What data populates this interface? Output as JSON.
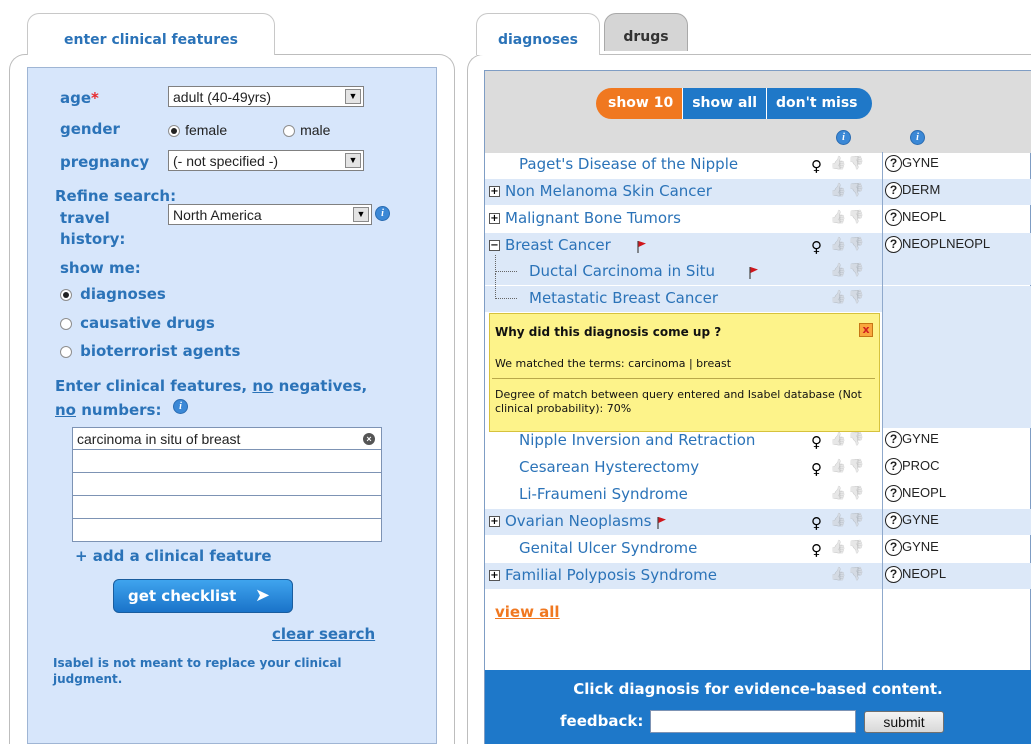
{
  "left_tab": {
    "label": "enter clinical features"
  },
  "form": {
    "age_label": "age",
    "age_required_mark": "*",
    "age_value": "adult (40-49yrs)",
    "gender_label": "gender",
    "gender_options": [
      "female",
      "male"
    ],
    "gender_selected": "female",
    "pregnancy_label": "pregnancy",
    "pregnancy_value": "(- not specified -)",
    "refine_label": "Refine search:",
    "travel_label_1": "travel",
    "travel_label_2": "history:",
    "travel_value": "North America",
    "show_me_label": "show me:",
    "show_me_options": [
      "diagnoses",
      "causative drugs",
      "bioterrorist agents"
    ],
    "show_me_selected": "diagnoses",
    "features_heading_1": "Enter clinical features,",
    "features_heading_no1": "no",
    "features_heading_2": "negatives,",
    "features_heading_no2": "no",
    "features_heading_3": "numbers:",
    "features": [
      "carcinoma in situ of breast",
      "",
      "",
      "",
      ""
    ],
    "add_feature": "+ add a clinical feature",
    "get_checklist": "get checklist",
    "clear_search": "clear search",
    "disclaimer": "Isabel is not meant to replace your clinical judgment."
  },
  "right_tabs": {
    "diagnoses": "diagnoses",
    "drugs": "drugs"
  },
  "filter": {
    "show10": "show 10",
    "show_all": "show all",
    "dont_miss": "don't miss"
  },
  "diagnoses": [
    {
      "name": "Paget's Disease of the Nipple",
      "expander": "",
      "flag": false,
      "female": true,
      "category": "GYNE"
    },
    {
      "name": "Non Melanoma Skin Cancer",
      "expander": "+",
      "flag": false,
      "female": false,
      "category": "DERM"
    },
    {
      "name": "Malignant Bone Tumors",
      "expander": "+",
      "flag": false,
      "female": false,
      "category": "NEOPL"
    },
    {
      "name": "Breast Cancer",
      "expander": "−",
      "flag": true,
      "female": true,
      "category": "NEOPL"
    },
    {
      "name": "Ductal Carcinoma in Situ",
      "expander": "",
      "flag": true,
      "female": false,
      "category": ""
    },
    {
      "name": "Metastatic Breast Cancer",
      "expander": "",
      "flag": false,
      "female": false,
      "category": ""
    },
    {
      "name": "Nipple Inversion and Retraction",
      "expander": "",
      "flag": false,
      "female": true,
      "category": "GYNE"
    },
    {
      "name": "Cesarean Hysterectomy",
      "expander": "",
      "flag": false,
      "female": true,
      "category": "PROC"
    },
    {
      "name": "Li-Fraumeni Syndrome",
      "expander": "",
      "flag": false,
      "female": false,
      "category": "NEOPL"
    },
    {
      "name": "Ovarian Neoplasms",
      "expander": "+",
      "flag": true,
      "female": true,
      "category": "GYNE"
    },
    {
      "name": "Genital Ulcer Syndrome",
      "expander": "",
      "flag": false,
      "female": true,
      "category": "GYNE"
    },
    {
      "name": "Familial Polyposis Syndrome",
      "expander": "+",
      "flag": false,
      "female": false,
      "category": "NEOPL"
    }
  ],
  "why_box": {
    "title": "Why did this diagnosis come up ?",
    "close": "x",
    "matched_prefix": "We matched the terms:",
    "matched_terms": "carcinoma | breast",
    "degree_text": "Degree of match between query entered and Isabel database (Not clinical probability): 70%"
  },
  "view_all": "view all",
  "bottom": {
    "message": "Click diagnosis for evidence-based content.",
    "feedback_label": "feedback:",
    "feedback_value": "",
    "submit": "submit"
  },
  "colors": {
    "accent_blue": "#2b73b8",
    "orange": "#f07820",
    "panel_blue": "#d7e6fb",
    "bar_blue": "#1e78c9"
  }
}
